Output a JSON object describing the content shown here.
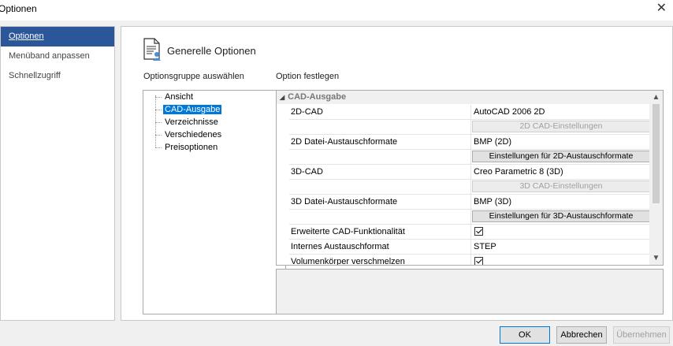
{
  "window": {
    "title": "Optionen",
    "close_glyph": "✕"
  },
  "sidebar": {
    "items": [
      {
        "label": "Optionen",
        "active": true
      },
      {
        "label": "Menüband anpassen",
        "active": false
      },
      {
        "label": "Schnellzugriff",
        "active": false
      }
    ]
  },
  "page": {
    "title": "Generelle Optionen",
    "icon": "options-document-icon",
    "group_label": "Optionsgruppe auswählen",
    "option_label": "Option festlegen"
  },
  "tree": {
    "items": [
      {
        "label": "Ansicht",
        "selected": false
      },
      {
        "label": "CAD-Ausgabe",
        "selected": true
      },
      {
        "label": "Verzeichnisse",
        "selected": false
      },
      {
        "label": "Verschiedenes",
        "selected": false
      },
      {
        "label": "Preisoptionen",
        "selected": false
      }
    ]
  },
  "grid": {
    "category": "CAD-Ausgabe",
    "rows": [
      {
        "name": "2D-CAD",
        "value": "AutoCAD 2006 2D"
      },
      {
        "name": "",
        "button": "2D CAD-Einstellungen",
        "disabled": true
      },
      {
        "name": "2D Datei-Austauschformate",
        "value": "BMP (2D)"
      },
      {
        "name": "",
        "button": "Einstellungen für 2D-Austauschformate",
        "disabled": false
      },
      {
        "name": "3D-CAD",
        "value": "Creo Parametric 8 (3D)"
      },
      {
        "name": "",
        "button": "3D CAD-Einstellungen",
        "disabled": true
      },
      {
        "name": "3D Datei-Austauschformate",
        "value": "BMP (3D)"
      },
      {
        "name": "",
        "button": "Einstellungen für 3D-Austauschformate",
        "disabled": false
      },
      {
        "name": "Erweiterte CAD-Funktionalität",
        "checked": true
      },
      {
        "name": "Internes Austauschformat",
        "value": "STEP"
      },
      {
        "name": "Volumenkörper verschmelzen",
        "checked": true
      }
    ]
  },
  "buttons": {
    "ok": "OK",
    "cancel": "Abbrechen",
    "apply": "Übernehmen"
  }
}
